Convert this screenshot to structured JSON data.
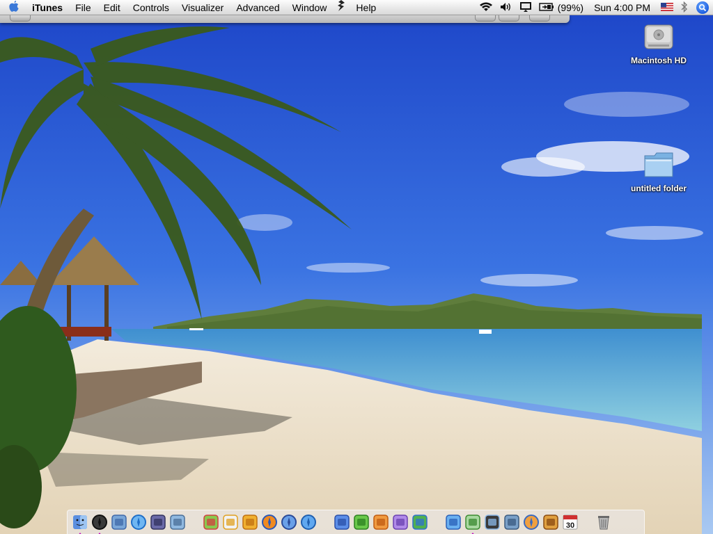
{
  "menubar": {
    "app_name": "iTunes",
    "menus": [
      "File",
      "Edit",
      "Controls",
      "Visualizer",
      "Advanced",
      "Window",
      "Help"
    ],
    "battery_text": "(99%)",
    "clock": "Sun 4:00 PM",
    "icons": [
      "apple-icon",
      "script-icon",
      "wifi-icon",
      "volume-icon",
      "display-icon",
      "battery-icon",
      "flag-icon",
      "bluetooth-icon",
      "spotlight-icon"
    ]
  },
  "desktop": {
    "icons": [
      {
        "label": "Macintosh HD",
        "icon": "hard-drive-icon"
      },
      {
        "label": "untitled folder",
        "icon": "folder-icon"
      }
    ]
  },
  "dock": {
    "apps": [
      {
        "name": "finder-icon",
        "running": true
      },
      {
        "name": "dashboard-icon",
        "running": true
      },
      {
        "name": "mail-icon",
        "running": false
      },
      {
        "name": "safari-icon",
        "running": false
      },
      {
        "name": "pen-app-icon",
        "running": false
      },
      {
        "name": "presentation-icon",
        "running": false
      },
      {
        "name": "graphic-tools-icon",
        "running": false
      },
      {
        "name": "checkmark-app-icon",
        "running": false
      },
      {
        "name": "dollar-app-icon",
        "running": false
      },
      {
        "name": "firefox-icon",
        "running": false
      },
      {
        "name": "thunderbird-icon",
        "running": false
      },
      {
        "name": "network-icon",
        "running": false
      },
      {
        "name": "word-icon",
        "running": false
      },
      {
        "name": "excel-icon",
        "running": false
      },
      {
        "name": "powerpoint-icon",
        "running": false
      },
      {
        "name": "entourage-icon",
        "running": false
      },
      {
        "name": "messenger-icon",
        "running": false
      },
      {
        "name": "ichat-icon",
        "running": false
      },
      {
        "name": "itunes-icon",
        "running": true
      },
      {
        "name": "imovie-icon",
        "running": false
      },
      {
        "name": "iphoto-icon",
        "running": false
      },
      {
        "name": "idvd-icon",
        "running": false
      },
      {
        "name": "garageband-icon",
        "running": false
      },
      {
        "name": "ical-icon",
        "running": false,
        "day": "30"
      },
      {
        "name": "trash-icon",
        "running": false
      }
    ]
  },
  "colors": {
    "sky_top": "#1f4fd6",
    "sky_bottom": "#8fb7f0",
    "sea": "#5fb5d8",
    "sand": "#efe6d4",
    "running_indicator": "#c000c0"
  }
}
